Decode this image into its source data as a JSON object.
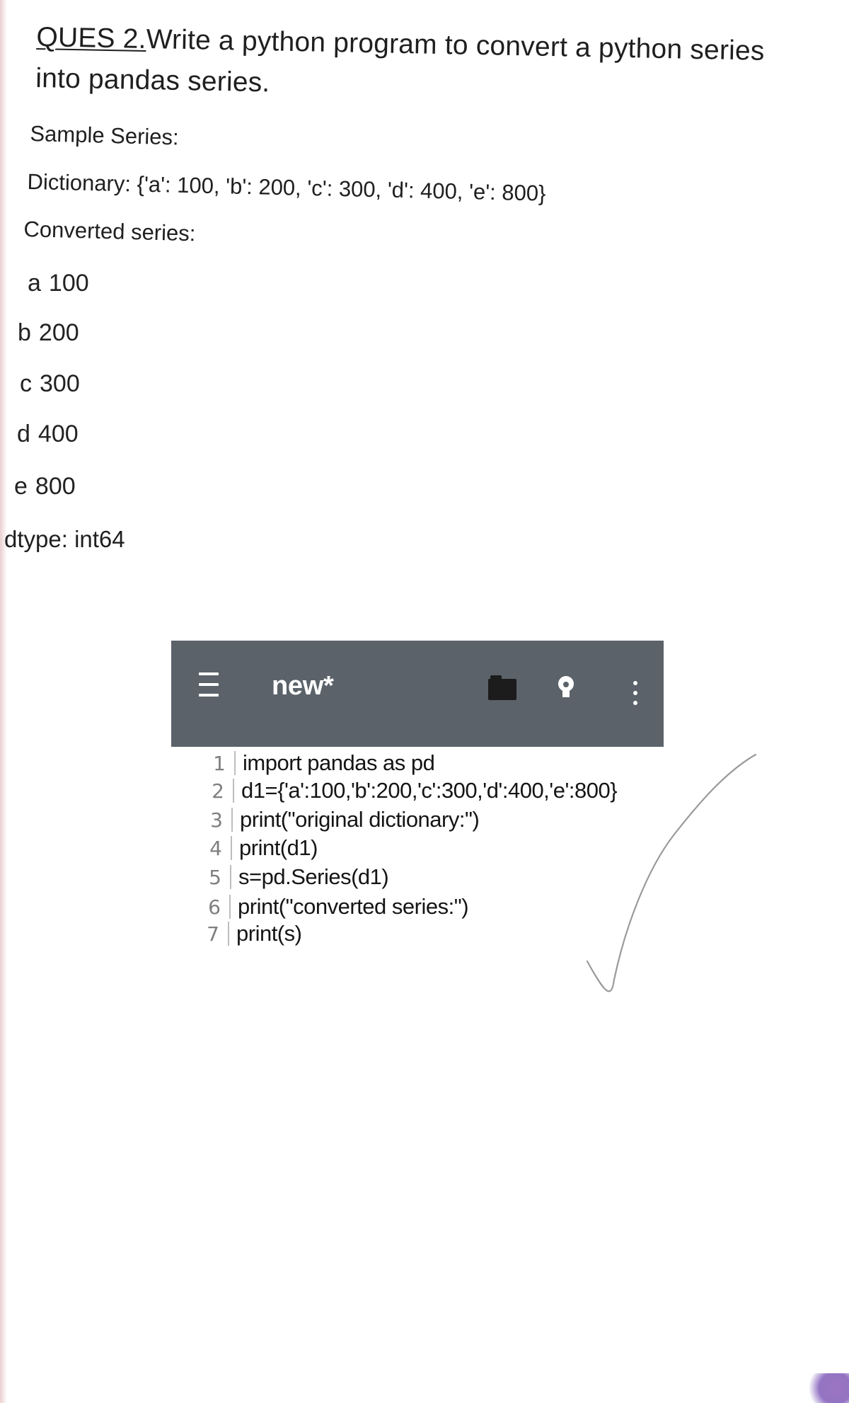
{
  "question": {
    "label": "QUES 2.",
    "text": "Write a python program to convert a python series into pandas series."
  },
  "sample_series_label": "Sample Series:",
  "dictionary_line": "Dictionary: {'a': 100, 'b': 200, 'c': 300, 'd': 400, 'e': 800}",
  "converted_series_label": "Converted series:",
  "series_rows": [
    {
      "key": "a",
      "value": "100"
    },
    {
      "key": "b",
      "value": "200"
    },
    {
      "key": "c",
      "value": "300"
    },
    {
      "key": "d",
      "value": "400"
    },
    {
      "key": "e",
      "value": "800"
    }
  ],
  "dtype_line": "dtype: int64",
  "editor": {
    "title": "new*",
    "icons": {
      "menu": "menu-icon",
      "folder": "folder-icon",
      "idea": "lightbulb-icon",
      "more": "more-vertical-icon"
    },
    "lines": [
      {
        "num": "1",
        "text": "import pandas as pd"
      },
      {
        "num": "2",
        "text": "d1={'a':100,'b':200,'c':300,'d':400,'e':800}"
      },
      {
        "num": "3",
        "text": "print(\"original dictionary:\")"
      },
      {
        "num": "4",
        "text": "print(d1)"
      },
      {
        "num": "5",
        "text": "s=pd.Series(d1)"
      },
      {
        "num": "6",
        "text": "print(\"converted series:\")"
      },
      {
        "num": "7",
        "text": "print(s)"
      }
    ]
  },
  "colors": {
    "toolbar": "#5b626a",
    "page": "#ffffff",
    "text": "#1f1f1f",
    "line_number": "#7f7f7f",
    "checkmark": "#9a9a9a"
  }
}
